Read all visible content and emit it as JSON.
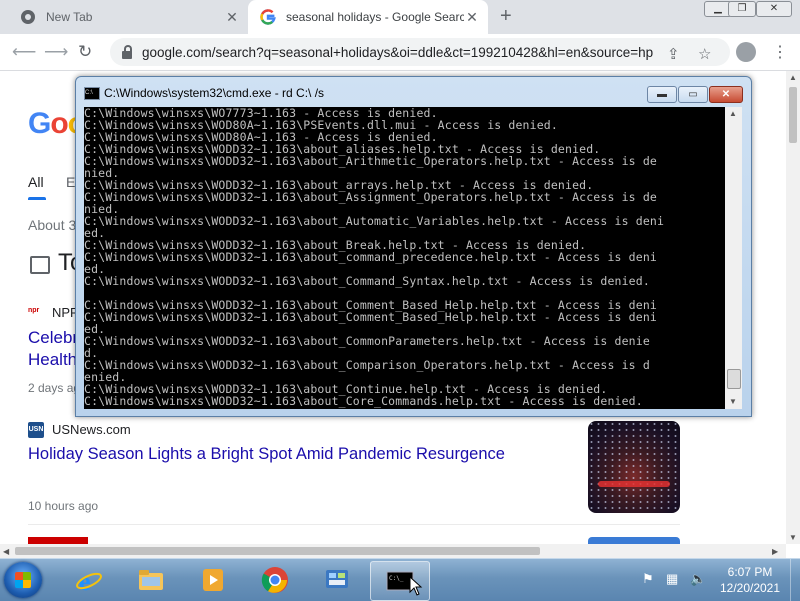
{
  "browser": {
    "tabs": [
      {
        "title": "New Tab",
        "active": false
      },
      {
        "title": "seasonal holidays - Google Search",
        "active": true
      }
    ],
    "new_tab_symbol": "+",
    "url": "google.com/search?q=seasonal+holidays&oi=ddle&ct=199210428&hl=en&source=hp",
    "window_controls": [
      "minimize",
      "maximize",
      "close"
    ]
  },
  "page": {
    "logo_text": "Goo",
    "tabs": [
      "All",
      "E"
    ],
    "about": "About 3",
    "topic_heading": "To",
    "result1": {
      "source": "NPR",
      "title": "Celebr Health",
      "age": "2 days ag"
    },
    "result2": {
      "source": "USNews.com",
      "title": "Holiday Season Lights a Bright Spot Amid Pandemic Resurgence",
      "age": "10 hours ago"
    }
  },
  "console": {
    "title": "C:\\Windows\\system32\\cmd.exe - rd  C:\\ /s",
    "lines": [
      "C:\\Windows\\winsxs\\WO7773~1.163 - Access is denied.",
      "C:\\Windows\\winsxs\\WOD80A~1.163\\PSEvents.dll.mui - Access is denied.",
      "C:\\Windows\\winsxs\\WOD80A~1.163 - Access is denied.",
      "C:\\Windows\\winsxs\\WODD32~1.163\\about_aliases.help.txt - Access is denied.",
      "C:\\Windows\\winsxs\\WODD32~1.163\\about_Arithmetic_Operators.help.txt - Access is de",
      "nied.",
      "C:\\Windows\\winsxs\\WODD32~1.163\\about_arrays.help.txt - Access is denied.",
      "C:\\Windows\\winsxs\\WODD32~1.163\\about_Assignment_Operators.help.txt - Access is de",
      "nied.",
      "C:\\Windows\\winsxs\\WODD32~1.163\\about_Automatic_Variables.help.txt - Access is deni",
      "ed.",
      "C:\\Windows\\winsxs\\WODD32~1.163\\about_Break.help.txt - Access is denied.",
      "C:\\Windows\\winsxs\\WODD32~1.163\\about_command_precedence.help.txt - Access is deni",
      "ed.",
      "C:\\Windows\\winsxs\\WODD32~1.163\\about_Command_Syntax.help.txt - Access is denied.",
      "",
      "C:\\Windows\\winsxs\\WODD32~1.163\\about_Comment_Based_Help.help.txt - Access is deni",
      "C:\\Windows\\winsxs\\WODD32~1.163\\about_Comment_Based_Help.help.txt - Access is deni",
      "ed.",
      "C:\\Windows\\winsxs\\WODD32~1.163\\about_CommonParameters.help.txt - Access is denie",
      "d.",
      "C:\\Windows\\winsxs\\WODD32~1.163\\about_Comparison_Operators.help.txt - Access is d",
      "enied.",
      "C:\\Windows\\winsxs\\WODD32~1.163\\about_Continue.help.txt - Access is denied.",
      "C:\\Windows\\winsxs\\WODD32~1.163\\about_Core_Commands.help.txt - Access is denied."
    ]
  },
  "taskbar": {
    "apps": [
      "internet-explorer",
      "windows-explorer",
      "media-player",
      "chrome",
      "control-panel",
      "command-prompt"
    ],
    "active_app": "command-prompt",
    "time": "6:07 PM",
    "date": "12/20/2021"
  },
  "colors": {
    "console_text": "#c0c0c0",
    "console_bg": "#000000",
    "link_blue": "#1a0dab",
    "taskbar": "#6a93ba"
  }
}
